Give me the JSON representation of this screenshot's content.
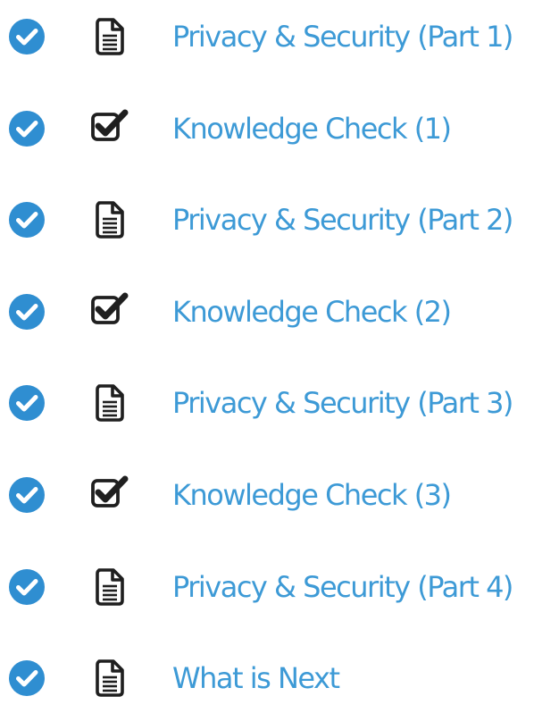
{
  "colors": {
    "link": "#3d9ad6",
    "status_fill": "#2f8ed1",
    "icon_stroke": "#1f1f1f"
  },
  "items": [
    {
      "label": "Privacy & Security (Part 1)",
      "type_icon": "document-icon",
      "status": "completed"
    },
    {
      "label": "Knowledge Check (1)",
      "type_icon": "checkbox-icon",
      "status": "completed"
    },
    {
      "label": "Privacy & Security (Part 2)",
      "type_icon": "document-icon",
      "status": "completed"
    },
    {
      "label": "Knowledge Check (2)",
      "type_icon": "checkbox-icon",
      "status": "completed"
    },
    {
      "label": "Privacy & Security (Part 3)",
      "type_icon": "document-icon",
      "status": "completed"
    },
    {
      "label": "Knowledge Check (3)",
      "type_icon": "checkbox-icon",
      "status": "completed"
    },
    {
      "label": "Privacy & Security (Part 4)",
      "type_icon": "document-icon",
      "status": "completed"
    },
    {
      "label": "What is Next",
      "type_icon": "document-icon",
      "status": "completed"
    }
  ]
}
